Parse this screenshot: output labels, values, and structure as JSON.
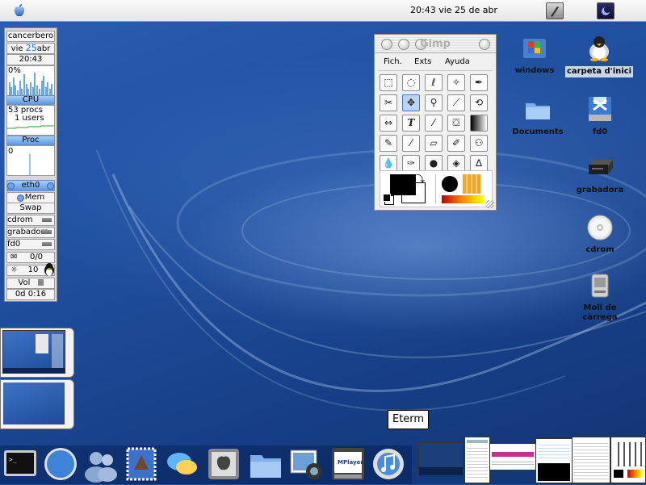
{
  "menubar": {
    "clock": "20:43 vie 25 de abr"
  },
  "monitor": {
    "host": "cancerbero",
    "day": "vie",
    "date_num": "25",
    "month": "abr",
    "time": "20:43",
    "cpu_percent": "0%",
    "cpu_label": "CPU",
    "procs": "53 procs",
    "users": "1 users",
    "proc_label": "Proc",
    "proc_value": "0",
    "eth_label": "eth0",
    "mem_label": "Mem",
    "swap_label": "Swap",
    "drive1": "cdrom",
    "drive2": "grabadora",
    "drive3": "fd0",
    "mail_count": "0/0",
    "load": "10",
    "vol_label": "Vol",
    "uptime": "0d  0:16"
  },
  "gimp": {
    "title": "Gimp",
    "menu": [
      "Fich.",
      "Exts",
      "Ayuda"
    ],
    "tools": [
      "rect-select",
      "ellipse-select",
      "free-select",
      "fuzzy-select",
      "bezier-select",
      "scissors",
      "move",
      "magnify",
      "crop",
      "transform",
      "flip",
      "text",
      "color-picker",
      "bucket-fill",
      "blend",
      "pencil",
      "paintbrush",
      "eraser",
      "airbrush",
      "clone",
      "smudge",
      "ink",
      "dodge-burn",
      "convolve",
      "measure"
    ]
  },
  "desktop_icons": [
    {
      "label": "windows",
      "icon": "windows-folder-icon"
    },
    {
      "label": "carpeta d'inici",
      "icon": "tux-home-icon"
    },
    {
      "label": "Documents",
      "icon": "folder-icon"
    },
    {
      "label": "fd0",
      "icon": "floppy-icon"
    },
    {
      "label": "grabadora",
      "icon": "cd-writer-icon"
    },
    {
      "label": "cdrom",
      "icon": "cdrom-icon"
    },
    {
      "label": "Moll de\ncàrrega",
      "icon": "hard-drive-icon"
    }
  ],
  "tooltip": "Eterm",
  "dock": {
    "apps": [
      "terminal",
      "safari",
      "users",
      "mail",
      "ichat",
      "preferences",
      "finder",
      "iphoto",
      "mplayer",
      "itunes"
    ],
    "mplayer_label": "MPlayer"
  }
}
